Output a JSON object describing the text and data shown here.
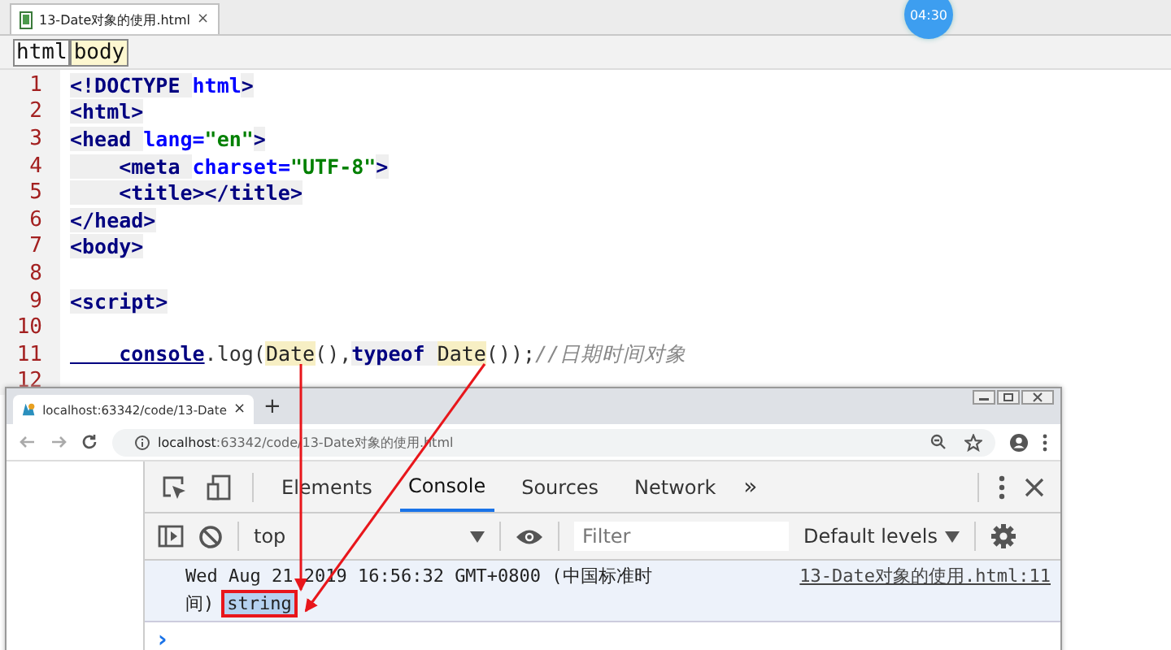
{
  "editor_tab": {
    "title": "13-Date对象的使用.html",
    "close": "×"
  },
  "time_badge": "04:30",
  "breadcrumbs": [
    {
      "label": "html",
      "selected": false
    },
    {
      "label": "body",
      "selected": true
    }
  ],
  "code_lines": [
    {
      "number": "1",
      "tokens": [
        {
          "text": "<!DOCTYPE ",
          "kind": "tag"
        },
        {
          "text": "html",
          "kind": "attr"
        },
        {
          "text": ">",
          "kind": "tag"
        }
      ]
    },
    {
      "number": "2",
      "tokens": [
        {
          "text": "<html>",
          "kind": "tag"
        }
      ]
    },
    {
      "number": "3",
      "tokens": [
        {
          "text": "<head ",
          "kind": "tag"
        },
        {
          "text": "lang=",
          "kind": "attr"
        },
        {
          "text": "\"en\"",
          "kind": "str"
        },
        {
          "text": ">",
          "kind": "tag"
        }
      ]
    },
    {
      "number": "4",
      "tokens": [
        {
          "text": "    <meta ",
          "kind": "tag"
        },
        {
          "text": "charset=",
          "kind": "attr"
        },
        {
          "text": "\"UTF-8\"",
          "kind": "str"
        },
        {
          "text": ">",
          "kind": "tag"
        }
      ]
    },
    {
      "number": "5",
      "tokens": [
        {
          "text": "    <title></title>",
          "kind": "tag"
        }
      ]
    },
    {
      "number": "6",
      "tokens": [
        {
          "text": "</head>",
          "kind": "tag"
        }
      ]
    },
    {
      "number": "7",
      "tokens": [
        {
          "text": "<body>",
          "kind": "tag"
        }
      ]
    },
    {
      "number": "8"
    },
    {
      "number": "9",
      "tokens": [
        {
          "text": "<script>",
          "kind": "tag"
        }
      ]
    },
    {
      "number": "10"
    },
    {
      "number": "11",
      "tokens": [
        {
          "text": "    console",
          "kind": "fn"
        },
        {
          "text": ".log(",
          "kind": "plain"
        },
        {
          "text": "Date",
          "kind": "hl"
        },
        {
          "text": "(),",
          "kind": "plain"
        },
        {
          "text": "typeof ",
          "kind": "tag"
        },
        {
          "text": "Date",
          "kind": "hl"
        },
        {
          "text": "());",
          "kind": "plain"
        },
        {
          "text": "//日期时间对象",
          "kind": "comment"
        }
      ]
    },
    {
      "number": "12"
    }
  ],
  "browser": {
    "tab": {
      "title": "localhost:63342/code/13-Date",
      "close": "×"
    },
    "new_tab": "+",
    "url": {
      "host": "localhost",
      "rest": ":63342/code/13-Date对象的使用.html"
    },
    "devtools": {
      "tabs": [
        {
          "label": "Elements",
          "selected": false
        },
        {
          "label": "Console",
          "selected": true
        },
        {
          "label": "Sources",
          "selected": false
        },
        {
          "label": "Network",
          "selected": false
        }
      ],
      "more": "»",
      "context": "top",
      "filter_placeholder": "Filter",
      "levels": "Default levels",
      "message_lines": [
        "Wed Aug 21 2019 16:56:32 GMT+0800 (中国标准时",
        "间)"
      ],
      "result": "string",
      "source": "13-Date对象的使用.html:11",
      "prompt": "›"
    }
  }
}
